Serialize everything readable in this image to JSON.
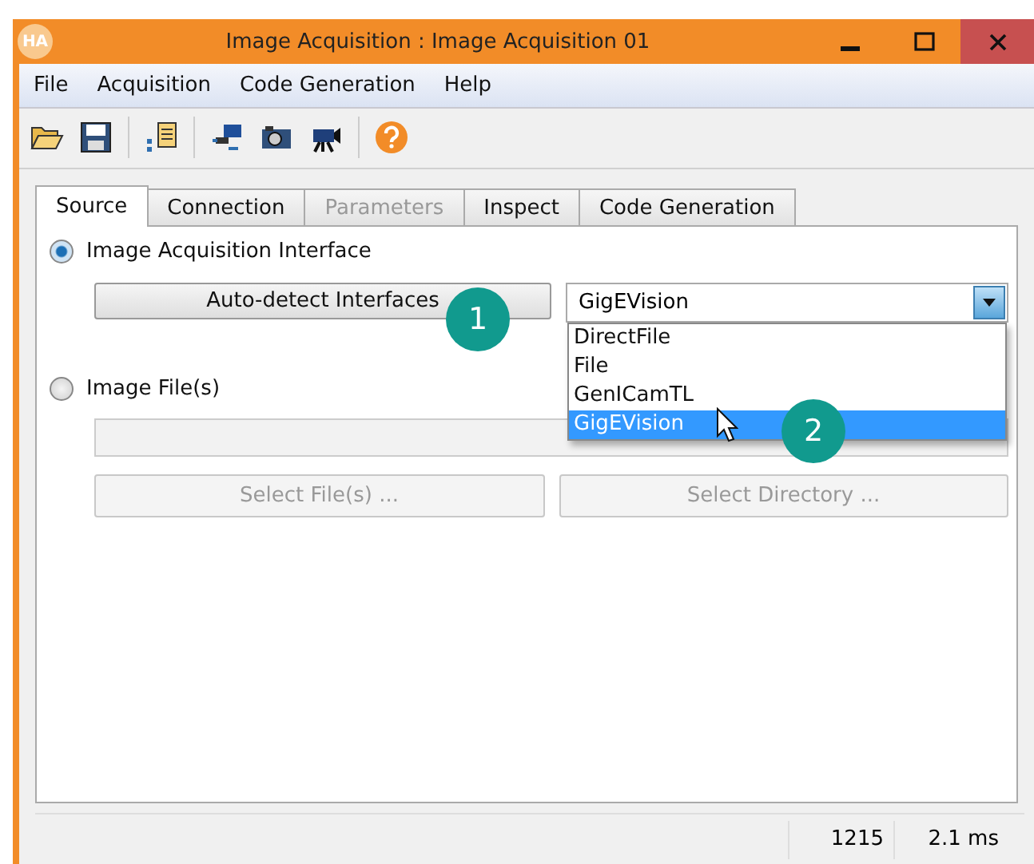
{
  "window": {
    "logo": "HA",
    "title": "Image Acquisition : Image Acquisition 01"
  },
  "menu": [
    "File",
    "Acquisition",
    "Code Generation",
    "Help"
  ],
  "tabs": [
    {
      "label": "Source",
      "selected": true,
      "disabled": false
    },
    {
      "label": "Connection",
      "selected": false,
      "disabled": false
    },
    {
      "label": "Parameters",
      "selected": false,
      "disabled": true
    },
    {
      "label": "Inspect",
      "selected": false,
      "disabled": false
    },
    {
      "label": "Code Generation",
      "selected": false,
      "disabled": false
    }
  ],
  "source": {
    "interface_option": {
      "label": "Image Acquisition Interface",
      "selected": true
    },
    "autodetect_button": "Auto-detect Interfaces",
    "interface_combo": {
      "value": "GigEVision",
      "expanded": true,
      "options": [
        {
          "label": "DirectFile",
          "selected": false
        },
        {
          "label": "File",
          "selected": false
        },
        {
          "label": "GenICamTL",
          "selected": false
        },
        {
          "label": "GigEVision",
          "selected": true
        }
      ]
    },
    "files_option": {
      "label": "Image File(s)",
      "selected": false
    },
    "select_files_button": {
      "label": "Select File(s) ...",
      "disabled": true
    },
    "select_directory_button": {
      "label": "Select Directory ...",
      "disabled": true
    }
  },
  "callouts": [
    "1",
    "2"
  ],
  "status_bar": [
    "1215",
    "2.1 ms"
  ]
}
